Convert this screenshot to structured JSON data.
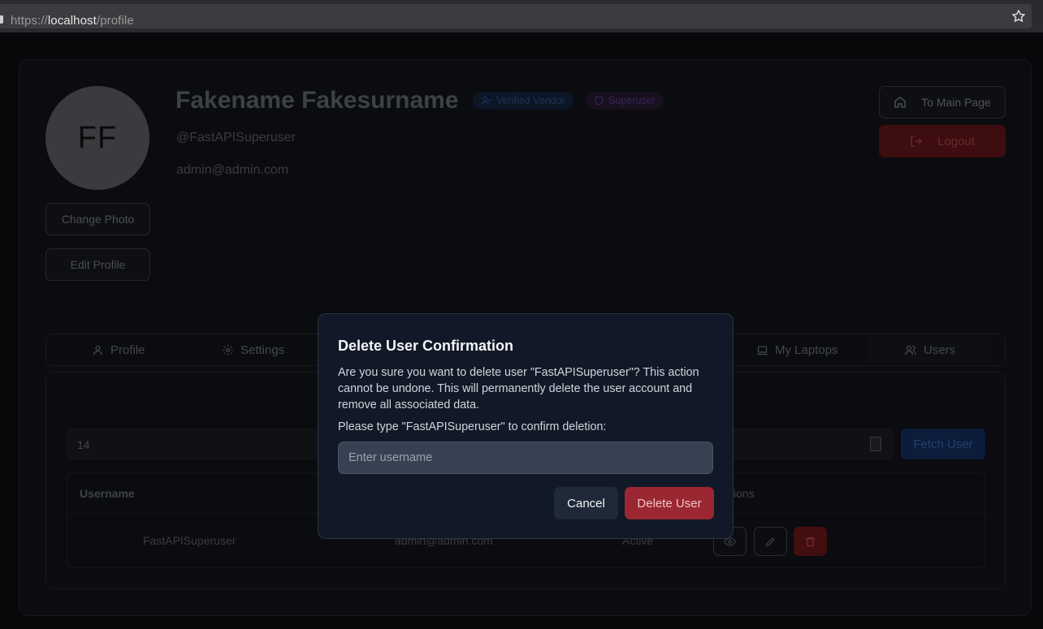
{
  "browser": {
    "url_scheme": "https://",
    "url_host": "localhost",
    "url_path": "/profile"
  },
  "profile": {
    "avatar_initials": "FF",
    "full_name": "Fakename Fakesurname",
    "badge_vendor": "Verified Vendor",
    "badge_superuser": "Superuser",
    "username": "@FastAPISuperuser",
    "email": "admin@admin.com",
    "change_photo_label": "Change Photo",
    "edit_profile_label": "Edit Profile",
    "main_page_label": "To Main Page",
    "logout_label": "Logout"
  },
  "tabs": [
    {
      "label": "Profile",
      "icon": "user-icon"
    },
    {
      "label": "Settings",
      "icon": "gear-icon"
    },
    {
      "label": "My Laptops",
      "icon": "laptop-icon"
    },
    {
      "label": "Users",
      "icon": "users-icon",
      "active": true
    }
  ],
  "users_panel": {
    "user_id_value": "14",
    "fetch_label": "Fetch User",
    "columns": [
      "Username",
      "ions"
    ],
    "row": {
      "username": "FastAPISuperuser",
      "email": "admin@admin.com",
      "status": "Active"
    }
  },
  "modal": {
    "title": "Delete User Confirmation",
    "description": "Are you sure you want to delete user \"FastAPISuperuser\"? This action cannot be undone. This will permanently delete the user account and remove all associated data.",
    "prompt": "Please type \"FastAPISuperuser\" to confirm deletion:",
    "input_placeholder": "Enter username",
    "cancel_label": "Cancel",
    "delete_label": "Delete User"
  },
  "colors": {
    "modal_bg": "#111827",
    "danger": "#9b2732",
    "overlay_bg": "#07080a"
  }
}
